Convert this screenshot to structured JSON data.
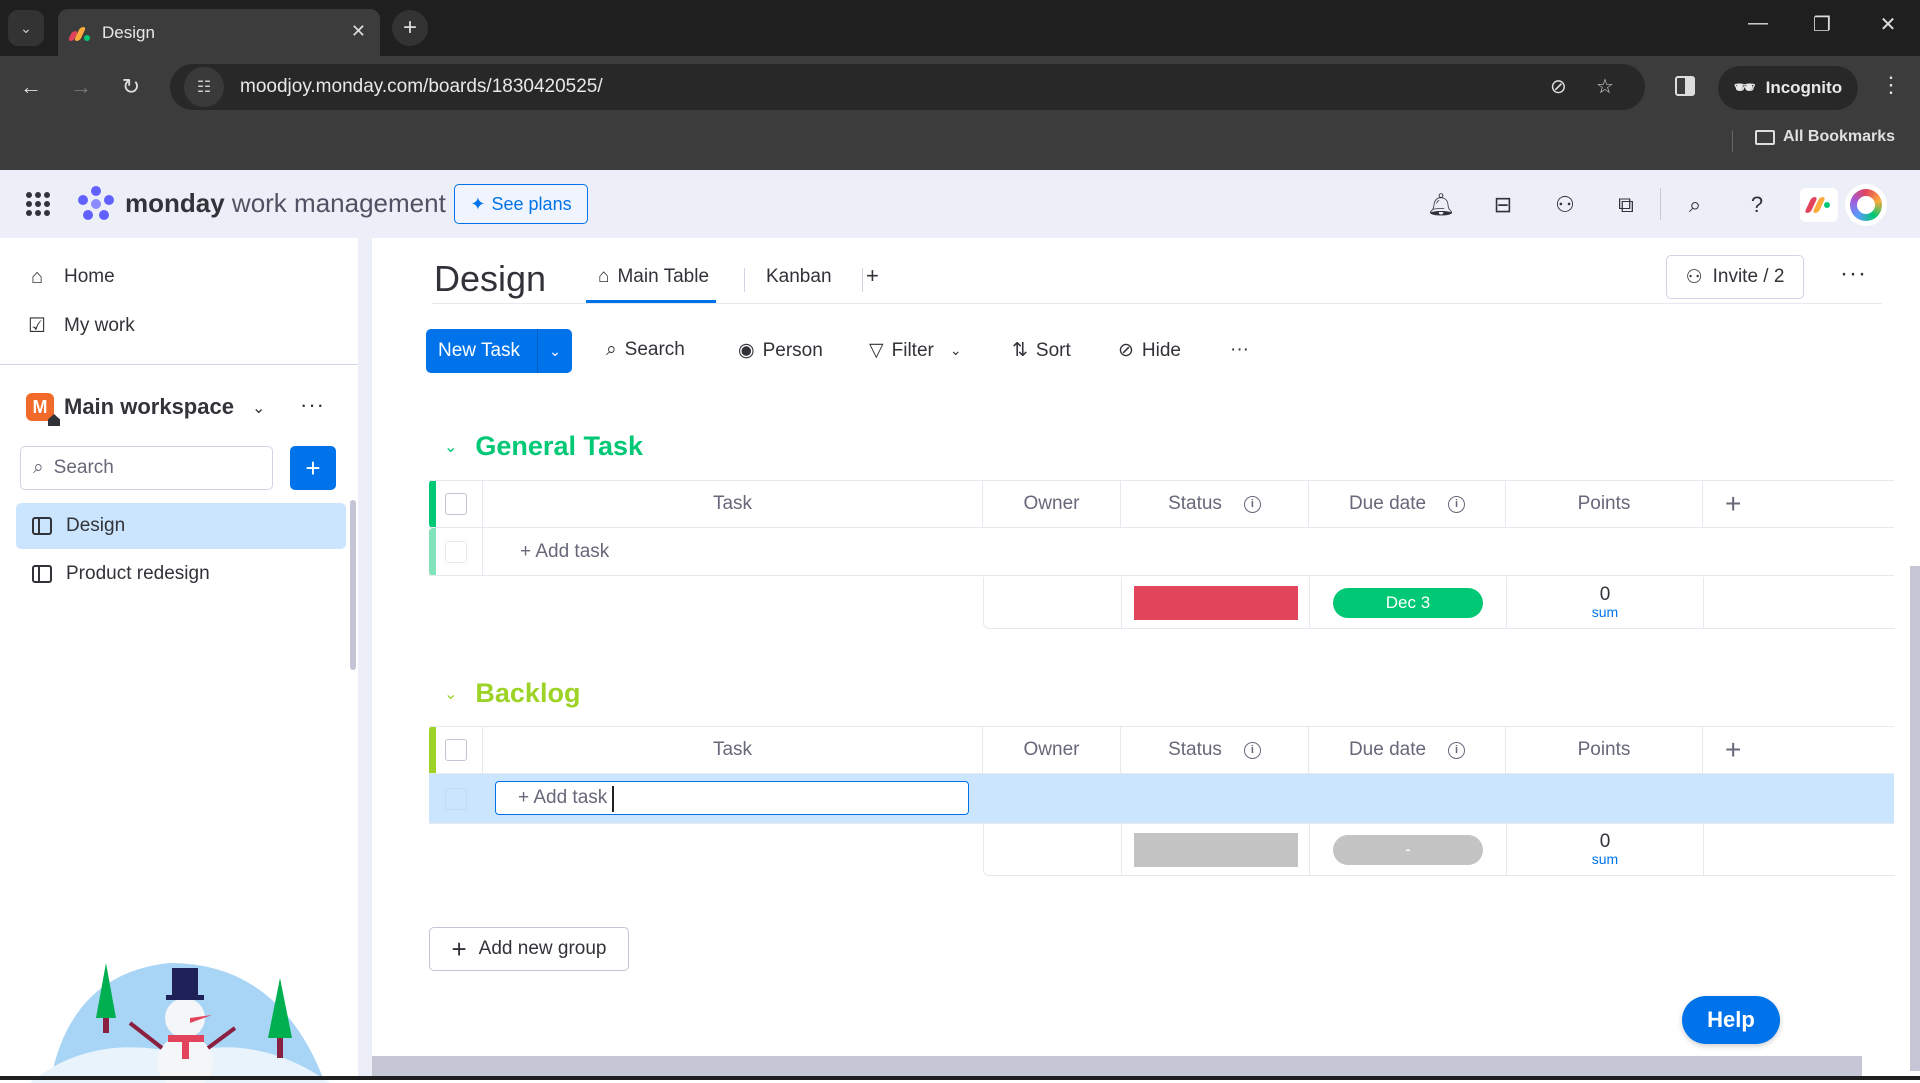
{
  "browser": {
    "tab_title": "Design",
    "url": "moodjoy.monday.com/boards/1830420525/",
    "incognito_label": "Incognito",
    "bookmarks_label": "All Bookmarks"
  },
  "header": {
    "brand_bold": "monday",
    "brand_rest": " work management",
    "see_plans": "See plans"
  },
  "sidebar": {
    "nav": [
      {
        "label": "Home",
        "icon": "home-icon"
      },
      {
        "label": "My work",
        "icon": "calendar-check-icon"
      }
    ],
    "workspace": {
      "badge": "M",
      "name": "Main workspace"
    },
    "search_placeholder": "Search",
    "boards": [
      {
        "label": "Design",
        "active": true
      },
      {
        "label": "Product redesign",
        "active": false
      }
    ]
  },
  "board": {
    "title": "Design",
    "views": [
      {
        "label": "Main Table",
        "active": true
      },
      {
        "label": "Kanban",
        "active": false
      }
    ],
    "add_view": "+",
    "invite_label": "Invite / 2",
    "toolbar": {
      "new_task": "New Task",
      "search": "Search",
      "person": "Person",
      "filter": "Filter",
      "sort": "Sort",
      "hide": "Hide"
    },
    "columns": [
      "Task",
      "Owner",
      "Status",
      "Due date",
      "Points"
    ],
    "groups": [
      {
        "title": "General Task",
        "color": "#00c875",
        "add_task": "+ Add task",
        "summary": {
          "status_color": "#e2445c",
          "due_label": "Dec 3",
          "due_color": "#00c875",
          "points_value": "0",
          "points_label": "sum"
        }
      },
      {
        "title": "Backlog",
        "color": "#9cd326",
        "add_task": "+ Add task",
        "summary": {
          "status_color": "#c4c4c4",
          "due_label": "-",
          "due_color": "#c4c4c4",
          "points_value": "0",
          "points_label": "sum"
        }
      }
    ],
    "add_group": "Add new group",
    "help": "Help"
  }
}
